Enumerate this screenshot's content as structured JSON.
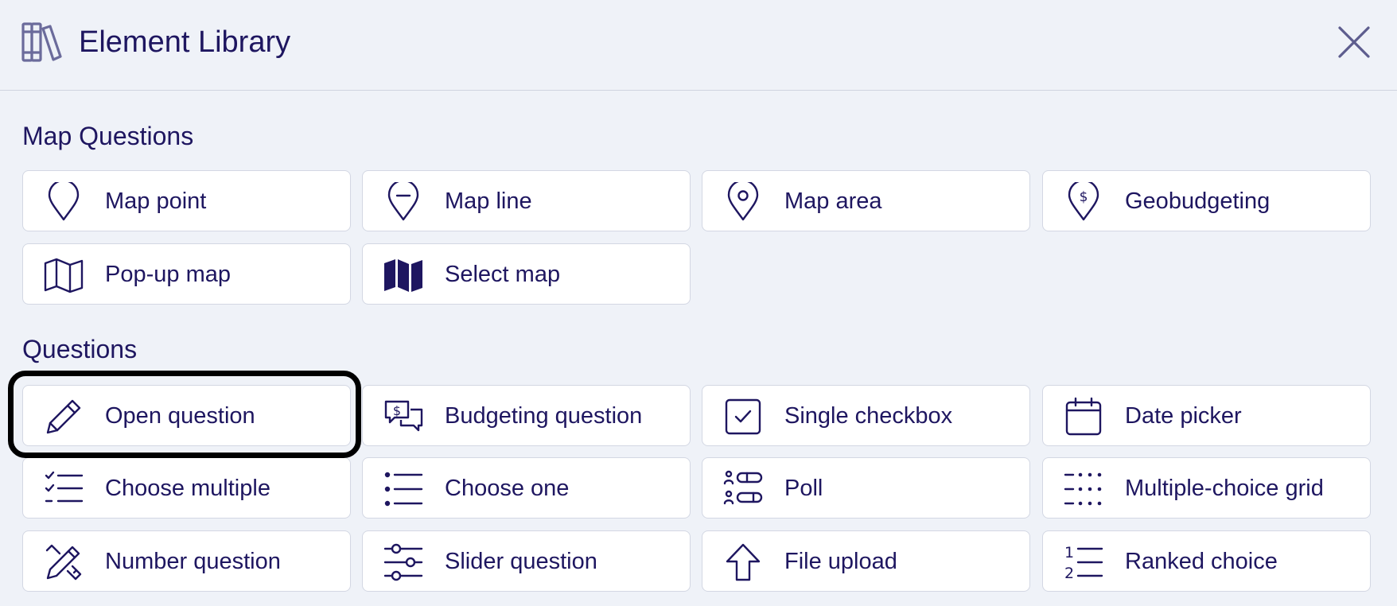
{
  "header": {
    "title": "Element Library",
    "icon": "books-icon",
    "close_icon": "close-icon"
  },
  "sections": {
    "map": {
      "title": "Map Questions",
      "items": [
        {
          "label": "Map point",
          "icon": "map-pin-icon"
        },
        {
          "label": "Map line",
          "icon": "map-line-pin-icon"
        },
        {
          "label": "Map area",
          "icon": "map-area-pin-icon"
        },
        {
          "label": "Geobudgeting",
          "icon": "dollar-pin-icon"
        },
        {
          "label": "Pop-up map",
          "icon": "map-outline-icon"
        },
        {
          "label": "Select map",
          "icon": "map-filled-icon"
        }
      ]
    },
    "questions": {
      "title": "Questions",
      "items": [
        {
          "label": "Open question",
          "icon": "pencil-icon",
          "focused": true
        },
        {
          "label": "Budgeting question",
          "icon": "dollar-chat-icon"
        },
        {
          "label": "Single checkbox",
          "icon": "checkbox-icon"
        },
        {
          "label": "Date picker",
          "icon": "calendar-icon"
        },
        {
          "label": "Choose multiple",
          "icon": "checklist-icon"
        },
        {
          "label": "Choose one",
          "icon": "bullet-list-icon"
        },
        {
          "label": "Poll",
          "icon": "poll-icon"
        },
        {
          "label": "Multiple-choice grid",
          "icon": "grid-icon"
        },
        {
          "label": "Number question",
          "icon": "pencil-ruler-icon"
        },
        {
          "label": "Slider question",
          "icon": "sliders-icon"
        },
        {
          "label": "File upload",
          "icon": "arrow-up-icon"
        },
        {
          "label": "Ranked choice",
          "icon": "numbered-list-icon"
        }
      ]
    }
  },
  "colors": {
    "background": "#eff2f8",
    "text": "#1e1660",
    "card": "#ffffff",
    "card_border": "#d3d7e3",
    "focus_ring": "#000000",
    "header_icon": "#6a6a9a"
  }
}
